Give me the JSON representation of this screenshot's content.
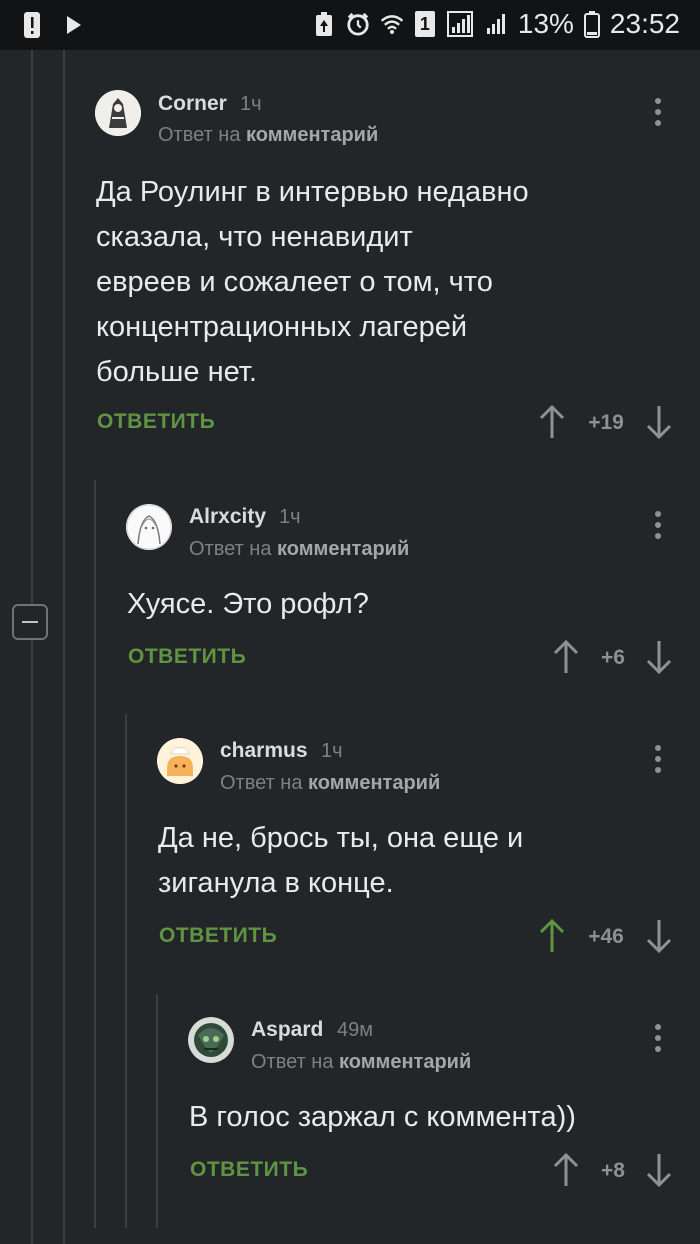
{
  "status_bar": {
    "battery_percent": "13%",
    "time": "23:52",
    "sim_label": "1"
  },
  "comments": [
    {
      "author": "Corner",
      "time": "1ч",
      "reply_prefix": "Ответ на",
      "reply_target": "комментарий",
      "lines": [
        "Да Роулинг в интервью недавно",
        "сказала, что ненавидит",
        "евреев и сожалеет о том, что",
        "концентрационных лагерей",
        "больше нет."
      ],
      "reply_label": "ОТВЕТИТЬ",
      "score": "+19",
      "upvoted": false
    },
    {
      "author": "Alrxcity",
      "time": "1ч",
      "reply_prefix": "Ответ на",
      "reply_target": "комментарий",
      "lines": [
        "Хуясе. Это рофл?"
      ],
      "reply_label": "ОТВЕТИТЬ",
      "score": "+6",
      "upvoted": false
    },
    {
      "author": "charmus",
      "time": "1ч",
      "reply_prefix": "Ответ на",
      "reply_target": "комментарий",
      "lines": [
        "Да не, брось ты, она еще и",
        "зиганула в конце."
      ],
      "reply_label": "ОТВЕТИТЬ",
      "score": "+46",
      "upvoted": true
    },
    {
      "author": "Aspard",
      "time": "49м",
      "reply_prefix": "Ответ на",
      "reply_target": "комментарий",
      "lines": [
        "В голос заржал с коммента))"
      ],
      "reply_label": "ОТВЕТИТЬ",
      "score": "+8",
      "upvoted": false
    }
  ],
  "colors": {
    "background": "#232629",
    "reply_green": "#5f9443",
    "upvote_active": "#5f9443",
    "arrow_default": "#8d9296"
  }
}
